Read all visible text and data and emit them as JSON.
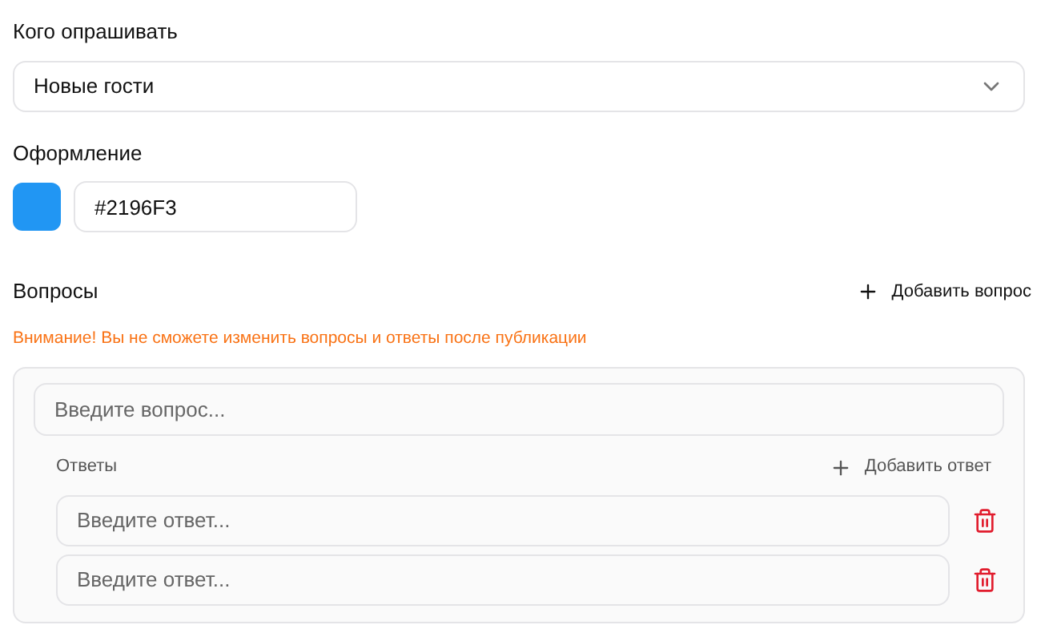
{
  "audience": {
    "label": "Кого опрашивать",
    "value": "Новые гости"
  },
  "design": {
    "label": "Оформление",
    "color": "#2196f3",
    "value": "#2196F3"
  },
  "questions": {
    "label": "Вопросы",
    "add_button": "Добавить вопрос",
    "warning": "Внимание! Вы не сможете изменить вопросы и ответы после публикации",
    "items": [
      {
        "placeholder": "Введите вопрос...",
        "answers_label": "Ответы",
        "add_answer": "Добавить ответ",
        "answers": [
          {
            "placeholder": "Введите ответ..."
          },
          {
            "placeholder": "Введите ответ..."
          }
        ]
      }
    ]
  }
}
